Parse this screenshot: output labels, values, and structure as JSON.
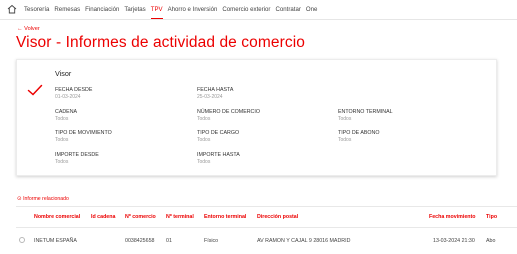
{
  "nav": {
    "items": [
      "Tesorería",
      "Remesas",
      "Financiación",
      "Tarjetas",
      "TPV",
      "Ahorro e Inversión",
      "Comercio exterior",
      "Contratar",
      "One"
    ],
    "active_index": 4
  },
  "back_link": "← Volver",
  "page_title": "Visor - Informes de actividad de comercio",
  "card": {
    "title": "Visor",
    "fields": {
      "fecha_desde": {
        "label": "Fecha desde",
        "value": "01-03-2024"
      },
      "fecha_hasta": {
        "label": "Fecha hasta",
        "value": "25-03-2024"
      },
      "cadena": {
        "label": "Cadena",
        "value": "Todos"
      },
      "numero_comercio": {
        "label": "Número de comercio",
        "value": "Todos"
      },
      "entorno_terminal": {
        "label": "Entorno terminal",
        "value": "Todos"
      },
      "tipo_movimiento": {
        "label": "Tipo de movimiento",
        "value": "Todos"
      },
      "tipo_cargo": {
        "label": "Tipo de cargo",
        "value": "Todos"
      },
      "tipo_abono": {
        "label": "Tipo de abono",
        "value": "Todos"
      },
      "importe_desde": {
        "label": "Importe desde",
        "value": "Todos"
      },
      "importe_hasta": {
        "label": "Importe hasta",
        "value": "Todos"
      }
    }
  },
  "related": {
    "symbol": "⊙",
    "label": "Informe relacionado"
  },
  "table": {
    "headers": {
      "nombre_comercial": "Nombre comercial",
      "id_cadena": "Id cadena",
      "n_comercio": "Nº comercio",
      "n_terminal": "Nº terminal",
      "entorno_terminal": "Entorno terminal",
      "direccion_postal": "Dirección postal",
      "fecha_movimiento": "Fecha movimiento",
      "tipo": "Tipo"
    },
    "rows": [
      {
        "nombre_comercial": "INETUM ESPAÑA",
        "id_cadena": "",
        "n_comercio": "0038425658",
        "n_terminal": "01",
        "entorno_terminal": "Físico",
        "direccion_postal": "AV RAMON Y CAJAL 9 28016 MADRID",
        "fecha_movimiento": "13-03-2024 21:30",
        "tipo": "Abo"
      }
    ]
  },
  "colors": {
    "accent": "#ec0000",
    "muted": "#9a9a9a"
  },
  "icons": {
    "home": "home-icon",
    "check": "check-icon"
  }
}
